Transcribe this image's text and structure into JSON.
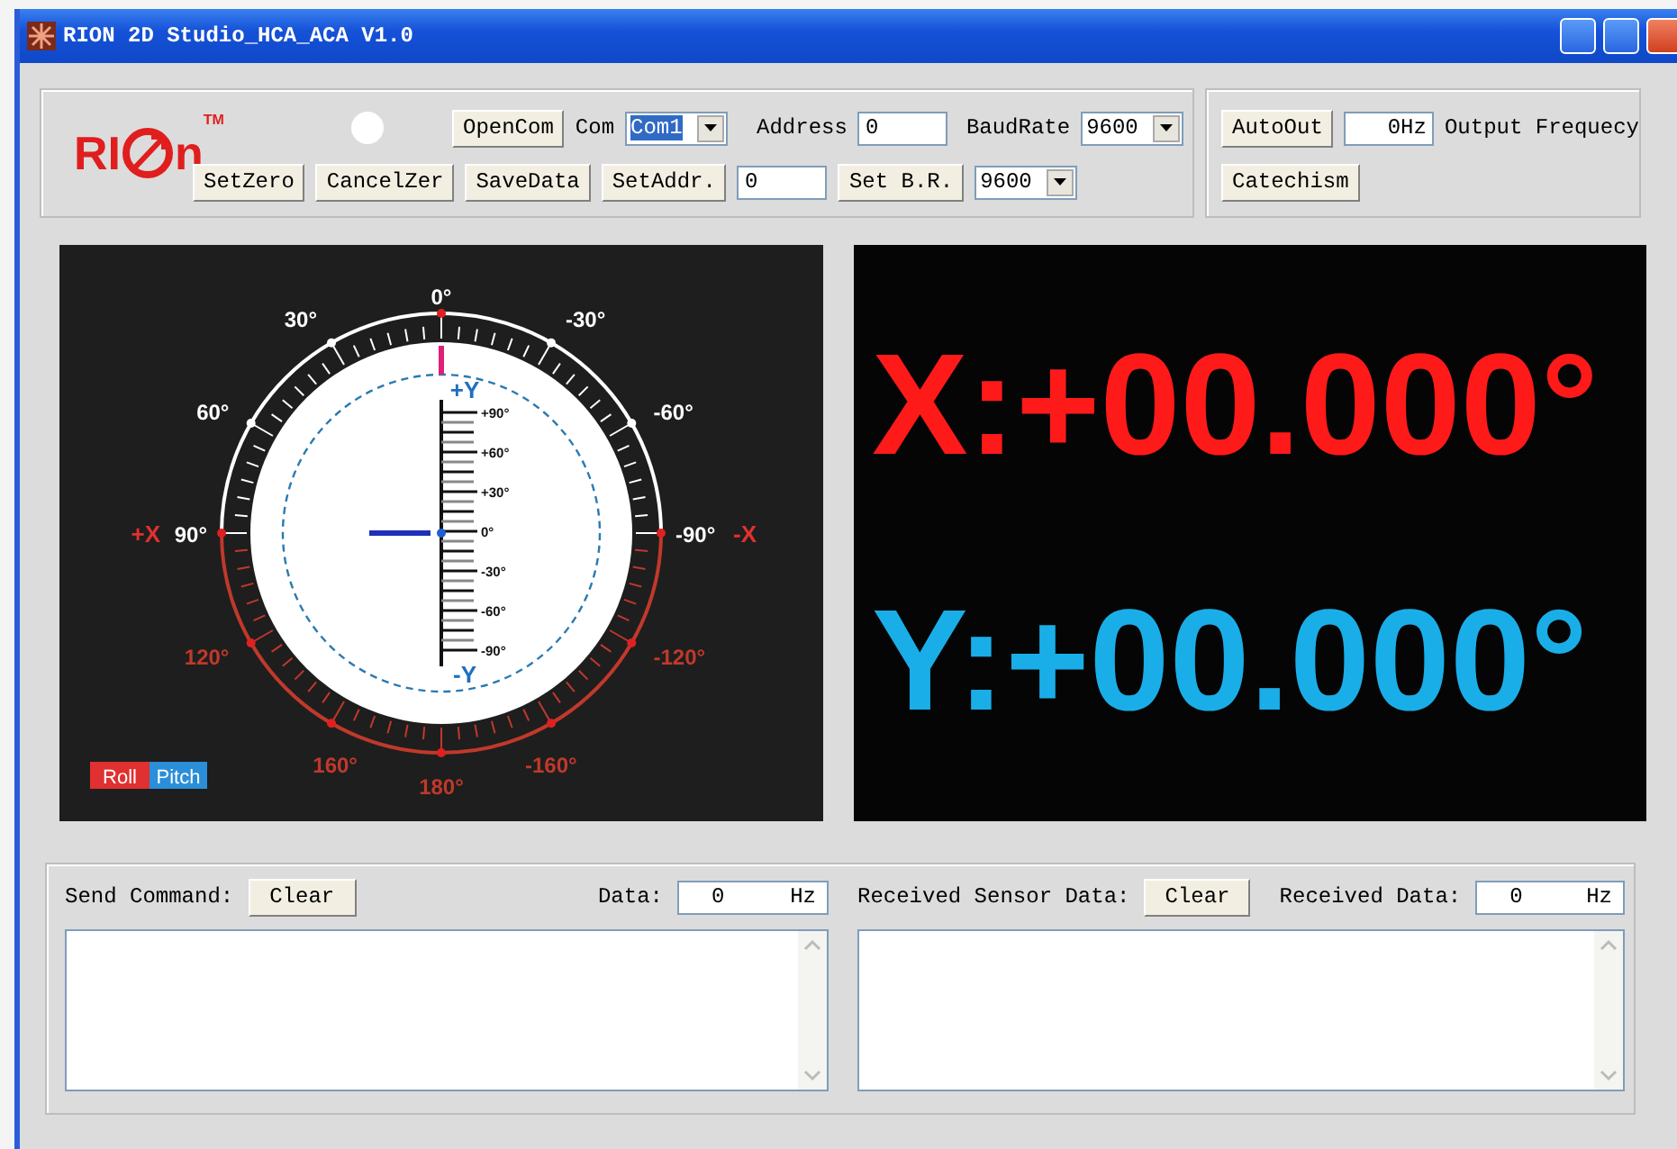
{
  "window": {
    "title": "RION 2D Studio_HCA_ACA V1.0"
  },
  "logo": {
    "left": "RI",
    "right": "n",
    "mark": "TM"
  },
  "connection": {
    "open_button": "OpenCom",
    "com_label": "Com",
    "com_value": "Com1",
    "address_label": "Address",
    "address_value": "0",
    "baud_label": "BaudRate",
    "baud_value": "9600",
    "set_zero_button": "SetZero",
    "cancel_zero_button": "CancelZer",
    "save_button": "SaveData",
    "set_address_button": "SetAddr.",
    "set_address_value": "0",
    "set_baud_button": "Set B.R.",
    "set_baud_value": "9600"
  },
  "output": {
    "auto_button": "AutoOut",
    "frequency_value": "0Hz",
    "frequency_label": "Output Frequecy",
    "catechism_button": "Catechism"
  },
  "gauge": {
    "roll_labels": [
      {
        "text": "0°",
        "color": "#ffffff"
      },
      {
        "text": "30°",
        "color": "#ffffff"
      },
      {
        "text": "-30°",
        "color": "#ffffff"
      },
      {
        "text": "60°",
        "color": "#ffffff"
      },
      {
        "text": "-60°",
        "color": "#ffffff"
      },
      {
        "text": "90°",
        "color": "#ffffff"
      },
      {
        "text": "-90°",
        "color": "#ffffff"
      },
      {
        "text": "120°",
        "color": "#c0392b"
      },
      {
        "text": "-120°",
        "color": "#c0392b"
      },
      {
        "text": "160°",
        "color": "#c0392b"
      },
      {
        "text": "-160°",
        "color": "#c0392b"
      },
      {
        "text": "180°",
        "color": "#c0392b"
      }
    ],
    "x_labels": [
      "+X",
      "-X"
    ],
    "y_labels": [
      "+Y",
      "-Y"
    ],
    "pitch_labels": [
      "+90°",
      "+60°",
      "+30°",
      "0°",
      "-30°",
      "-60°",
      "-90°"
    ],
    "legend": [
      "Roll",
      "Pitch"
    ]
  },
  "readouts": [
    {
      "text": "X:+00.000°",
      "color": "#ff1a1a"
    },
    {
      "text": "Y:+00.000°",
      "color": "#1aaee8"
    }
  ],
  "send": {
    "label": "Send Command:",
    "clear_button": "Clear",
    "data_label": "Data:",
    "data_value": "0",
    "data_unit": "Hz"
  },
  "receive": {
    "label": "Received Sensor Data:",
    "clear_button": "Clear",
    "data_label": "Received Data:",
    "data_value": "0",
    "data_unit": "Hz"
  }
}
